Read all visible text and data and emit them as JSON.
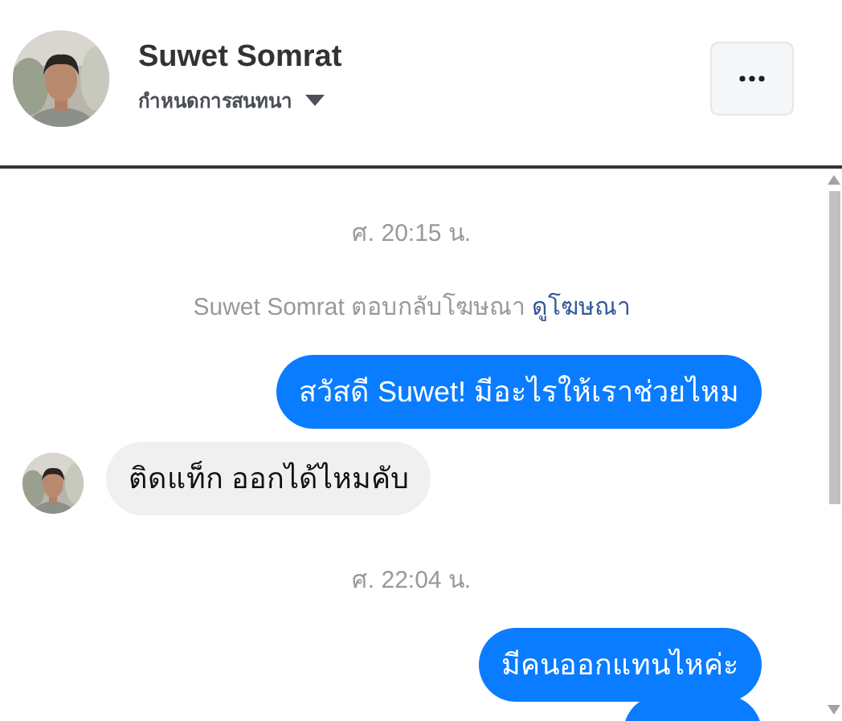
{
  "header": {
    "name": "Suwet Somrat",
    "subtitle": "กำหนดการสนทนา"
  },
  "messages": [
    {
      "kind": "timestamp",
      "text": "ศ. 20:15 น."
    },
    {
      "kind": "notice",
      "text": "Suwet Somrat ตอบกลับโฆษณา",
      "link": "ดูโฆษณา"
    },
    {
      "kind": "outgoing",
      "text": "สวัสดี Suwet! มีอะไรให้เราช่วยไหม"
    },
    {
      "kind": "incoming",
      "text": "ติดแท็ก ออกได้ไหมคับ"
    },
    {
      "kind": "timestamp",
      "text": "ศ. 22:04 น."
    },
    {
      "kind": "outgoing",
      "text": "มีคนออกแทนไหค่ะ"
    },
    {
      "kind": "outgoing"
    }
  ]
}
